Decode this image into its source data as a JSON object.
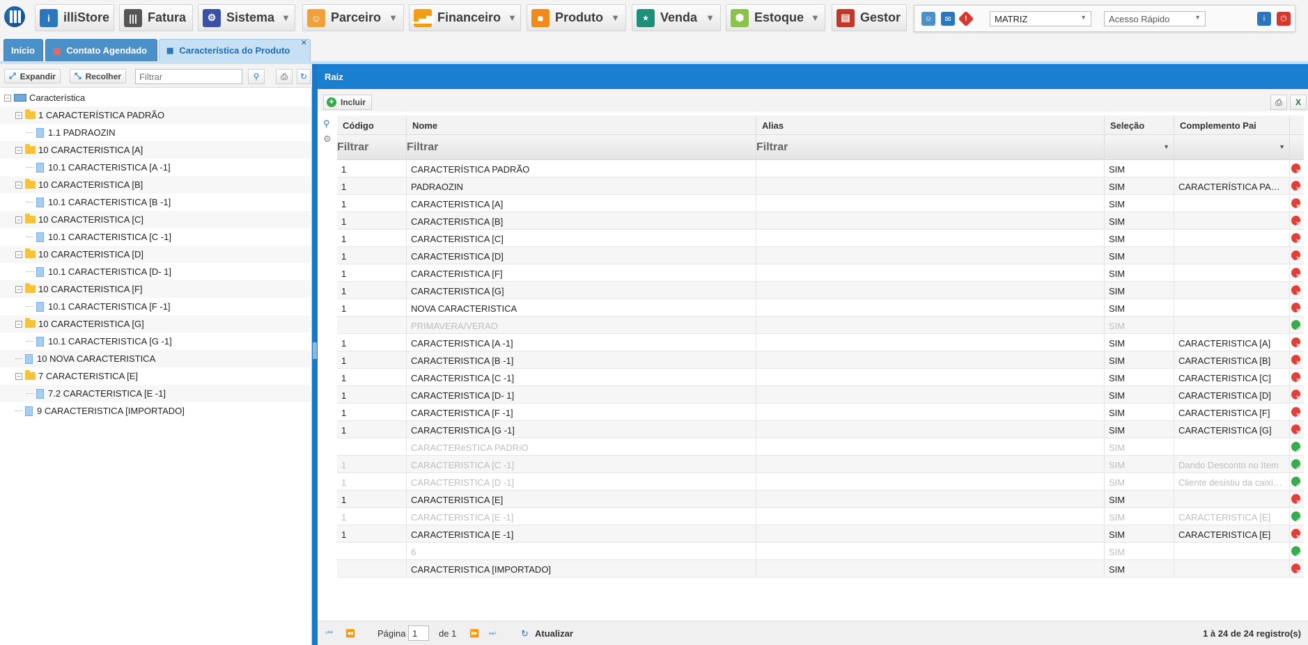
{
  "topbar": {
    "menus": [
      {
        "label": "illiStore",
        "icon": "illistore-icon",
        "color": "#2a77c0",
        "caret": false
      },
      {
        "label": "Fatura",
        "icon": "barcode-icon",
        "color": "#555555",
        "caret": false
      },
      {
        "label": "Sistema",
        "icon": "gear-icon",
        "color": "#3a4fa6",
        "caret": true
      },
      {
        "label": "Parceiro",
        "icon": "people-icon",
        "color": "#f0a13a",
        "caret": true
      },
      {
        "label": "Financeiro",
        "icon": "bar-chart-icon",
        "color": "#f29d1a",
        "caret": true
      },
      {
        "label": "Produto",
        "icon": "box-icon",
        "color": "#f08a1a",
        "caret": true
      },
      {
        "label": "Venda",
        "icon": "cart-icon",
        "color": "#1f8f7a",
        "caret": true
      },
      {
        "label": "Estoque",
        "icon": "hand-box-icon",
        "color": "#8bc34a",
        "caret": true
      },
      {
        "label": "Gestor",
        "icon": "presentation-icon",
        "color": "#c0392b",
        "caret": false
      }
    ],
    "branch": "MATRIZ",
    "quick_access_placeholder": "Acesso Rápido"
  },
  "tabs": [
    {
      "label": "Início",
      "active": false
    },
    {
      "label": "Contato Agendado",
      "active": false
    },
    {
      "label": "Característica do Produto",
      "active": true
    }
  ],
  "left": {
    "expand_label": "Expandir",
    "collapse_label": "Recolher",
    "filter_placeholder": "Filtrar",
    "tree": [
      {
        "label": "Característica",
        "level": 0,
        "kind": "root"
      },
      {
        "label": "1 CARACTERÍSTICA PADRÃO",
        "level": 1,
        "kind": "folder"
      },
      {
        "label": "1.1 PADRAOZIN",
        "level": 2,
        "kind": "doc"
      },
      {
        "label": "10 CARACTERISTICA [A]",
        "level": 1,
        "kind": "folder"
      },
      {
        "label": "10.1 CARACTERISTICA [A -1]",
        "level": 2,
        "kind": "doc"
      },
      {
        "label": "10 CARACTERISTICA [B]",
        "level": 1,
        "kind": "folder"
      },
      {
        "label": "10.1 CARACTERISTICA [B -1]",
        "level": 2,
        "kind": "doc"
      },
      {
        "label": "10 CARACTERISTICA [C]",
        "level": 1,
        "kind": "folder"
      },
      {
        "label": "10.1 CARACTERISTICA [C -1]",
        "level": 2,
        "kind": "doc"
      },
      {
        "label": "10 CARACTERISTICA [D]",
        "level": 1,
        "kind": "folder"
      },
      {
        "label": "10.1 CARACTERISTICA [D- 1]",
        "level": 2,
        "kind": "doc"
      },
      {
        "label": "10 CARACTERISTICA [F]",
        "level": 1,
        "kind": "folder"
      },
      {
        "label": "10.1 CARACTERISTICA [F -1]",
        "level": 2,
        "kind": "doc"
      },
      {
        "label": "10 CARACTERISTICA [G]",
        "level": 1,
        "kind": "folder"
      },
      {
        "label": "10.1 CARACTERISTICA [G -1]",
        "level": 2,
        "kind": "doc"
      },
      {
        "label": "10 NOVA CARACTERISTICA",
        "level": 1,
        "kind": "doc"
      },
      {
        "label": "7 CARACTERISTICA [E]",
        "level": 1,
        "kind": "folder"
      },
      {
        "label": "7.2 CARACTERISTICA [E -1]",
        "level": 2,
        "kind": "doc"
      },
      {
        "label": "9 CARACTERISTICA [IMPORTADO]",
        "level": 1,
        "kind": "doc"
      }
    ]
  },
  "right": {
    "header": "Raiz",
    "add_label": "Incluir",
    "columns": [
      "Código",
      "Nome",
      "Alias",
      "Seleção",
      "Complemento Pai"
    ],
    "filters": [
      "Filtrar",
      "Filtrar",
      "Filtrar",
      "",
      ""
    ],
    "rows": [
      {
        "codigo": "1",
        "nome": "CARACTERÍSTICA PADRÃO",
        "alias": "",
        "selecao": "SIM",
        "pai": "",
        "status": "del",
        "disabled": false
      },
      {
        "codigo": "1",
        "nome": "PADRAOZIN",
        "alias": "",
        "selecao": "SIM",
        "pai": "CARACTERÍSTICA PADRÃO",
        "status": "del",
        "disabled": false
      },
      {
        "codigo": "1",
        "nome": "CARACTERISTICA [A]",
        "alias": "",
        "selecao": "SIM",
        "pai": "",
        "status": "del",
        "disabled": false
      },
      {
        "codigo": "1",
        "nome": "CARACTERISTICA [B]",
        "alias": "",
        "selecao": "SIM",
        "pai": "",
        "status": "del",
        "disabled": false
      },
      {
        "codigo": "1",
        "nome": "CARACTERISTICA [C]",
        "alias": "",
        "selecao": "SIM",
        "pai": "",
        "status": "del",
        "disabled": false
      },
      {
        "codigo": "1",
        "nome": "CARACTERISTICA [D]",
        "alias": "",
        "selecao": "SIM",
        "pai": "",
        "status": "del",
        "disabled": false
      },
      {
        "codigo": "1",
        "nome": "CARACTERISTICA [F]",
        "alias": "",
        "selecao": "SIM",
        "pai": "",
        "status": "del",
        "disabled": false
      },
      {
        "codigo": "1",
        "nome": "CARACTERISTICA [G]",
        "alias": "",
        "selecao": "SIM",
        "pai": "",
        "status": "del",
        "disabled": false
      },
      {
        "codigo": "1",
        "nome": "NOVA CARACTERISTICA",
        "alias": "",
        "selecao": "SIM",
        "pai": "",
        "status": "del",
        "disabled": false
      },
      {
        "codigo": "",
        "nome": "PRIMAVERA/VERAO",
        "alias": "",
        "selecao": "SIM",
        "pai": "",
        "status": "ok",
        "disabled": true
      },
      {
        "codigo": "1",
        "nome": "CARACTERISTICA [A -1]",
        "alias": "",
        "selecao": "SIM",
        "pai": "CARACTERISTICA [A]",
        "status": "del",
        "disabled": false
      },
      {
        "codigo": "1",
        "nome": "CARACTERISTICA [B -1]",
        "alias": "",
        "selecao": "SIM",
        "pai": "CARACTERISTICA [B]",
        "status": "del",
        "disabled": false
      },
      {
        "codigo": "1",
        "nome": "CARACTERISTICA [C -1]",
        "alias": "",
        "selecao": "SIM",
        "pai": "CARACTERISTICA [C]",
        "status": "del",
        "disabled": false
      },
      {
        "codigo": "1",
        "nome": "CARACTERISTICA [D- 1]",
        "alias": "",
        "selecao": "SIM",
        "pai": "CARACTERISTICA [D]",
        "status": "del",
        "disabled": false
      },
      {
        "codigo": "1",
        "nome": "CARACTERISTICA [F -1]",
        "alias": "",
        "selecao": "SIM",
        "pai": "CARACTERISTICA [F]",
        "status": "del",
        "disabled": false
      },
      {
        "codigo": "1",
        "nome": "CARACTERISTICA [G -1]",
        "alias": "",
        "selecao": "SIM",
        "pai": "CARACTERISTICA [G]",
        "status": "del",
        "disabled": false
      },
      {
        "codigo": "",
        "nome": "CARACTERéSTICA PADRíO",
        "alias": "",
        "selecao": "SIM",
        "pai": "",
        "status": "ok",
        "disabled": true
      },
      {
        "codigo": "1",
        "nome": "CARACTERISTICA [C -1]",
        "alias": "",
        "selecao": "SIM",
        "pai": "Dando Desconto no Item",
        "status": "ok",
        "disabled": true
      },
      {
        "codigo": "1",
        "nome": "CARACTERISTICA [D -1]",
        "alias": "",
        "selecao": "SIM",
        "pai": "Cliente desistiu da caixinha",
        "status": "ok",
        "disabled": true
      },
      {
        "codigo": "1",
        "nome": "CARACTERISTICA [E]",
        "alias": "",
        "selecao": "SIM",
        "pai": "",
        "status": "del",
        "disabled": false
      },
      {
        "codigo": "1",
        "nome": "CARACTERISTICA [E -1]",
        "alias": "",
        "selecao": "SIM",
        "pai": "CARACTERISTICA [E]",
        "status": "ok",
        "disabled": true
      },
      {
        "codigo": "1",
        "nome": "CARACTERISTICA [E -1]",
        "alias": "",
        "selecao": "SIM",
        "pai": "CARACTERISTICA [E]",
        "status": "del",
        "disabled": false
      },
      {
        "codigo": "",
        "nome": "6",
        "alias": "",
        "selecao": "SIM",
        "pai": "",
        "status": "ok",
        "disabled": true
      },
      {
        "codigo": "",
        "nome": "CARACTERISTICA [IMPORTADO]",
        "alias": "",
        "selecao": "SIM",
        "pai": "",
        "status": "del",
        "disabled": false
      }
    ],
    "pager": {
      "page_label": "Página",
      "page": "1",
      "of_label": "de 1",
      "refresh_label": "Atualizar",
      "summary": "1 à 24 de 24 registro(s)"
    }
  }
}
